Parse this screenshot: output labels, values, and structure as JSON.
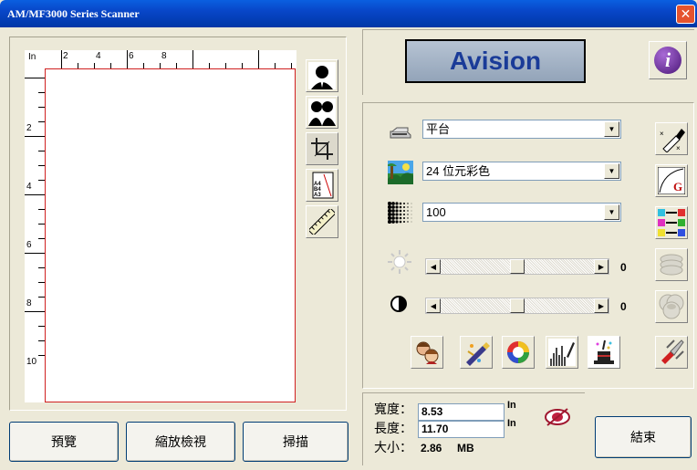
{
  "window": {
    "title": "AM/MF3000 Series Scanner",
    "close_glyph": "✕"
  },
  "ruler": {
    "unit": "In",
    "top_labels": [
      "2",
      "4",
      "6",
      "8"
    ],
    "left_labels": [
      "2",
      "4",
      "6",
      "8",
      "10"
    ]
  },
  "left_buttons": {
    "preview": "預覽",
    "zoom": "縮放檢視",
    "scan": "掃描"
  },
  "brand": {
    "logo_text": "Avision",
    "logo_color": "#1a3b98",
    "info_glyph": "i"
  },
  "settings": {
    "source": {
      "value": "平台",
      "icon": "flatbed-icon"
    },
    "mode": {
      "value": "24 位元彩色",
      "icon": "color-photo-icon"
    },
    "resolution": {
      "value": "100",
      "icon": "halftone-icon"
    },
    "brightness": {
      "value": "0",
      "level": 0.5,
      "icon": "sun-icon"
    },
    "contrast": {
      "value": "0",
      "level": 0.5,
      "icon": "contrast-icon"
    }
  },
  "dimensions": {
    "width_label": "寬度：",
    "width_value": "8.53",
    "height_label": "長度：",
    "height_value": "11.70",
    "size_label": "大小：",
    "size_value": "2.86",
    "size_unit": "MB",
    "unit": "In"
  },
  "exit_button": "結束",
  "accent_color": "#0846c8",
  "preview_border_color": "#d02020"
}
